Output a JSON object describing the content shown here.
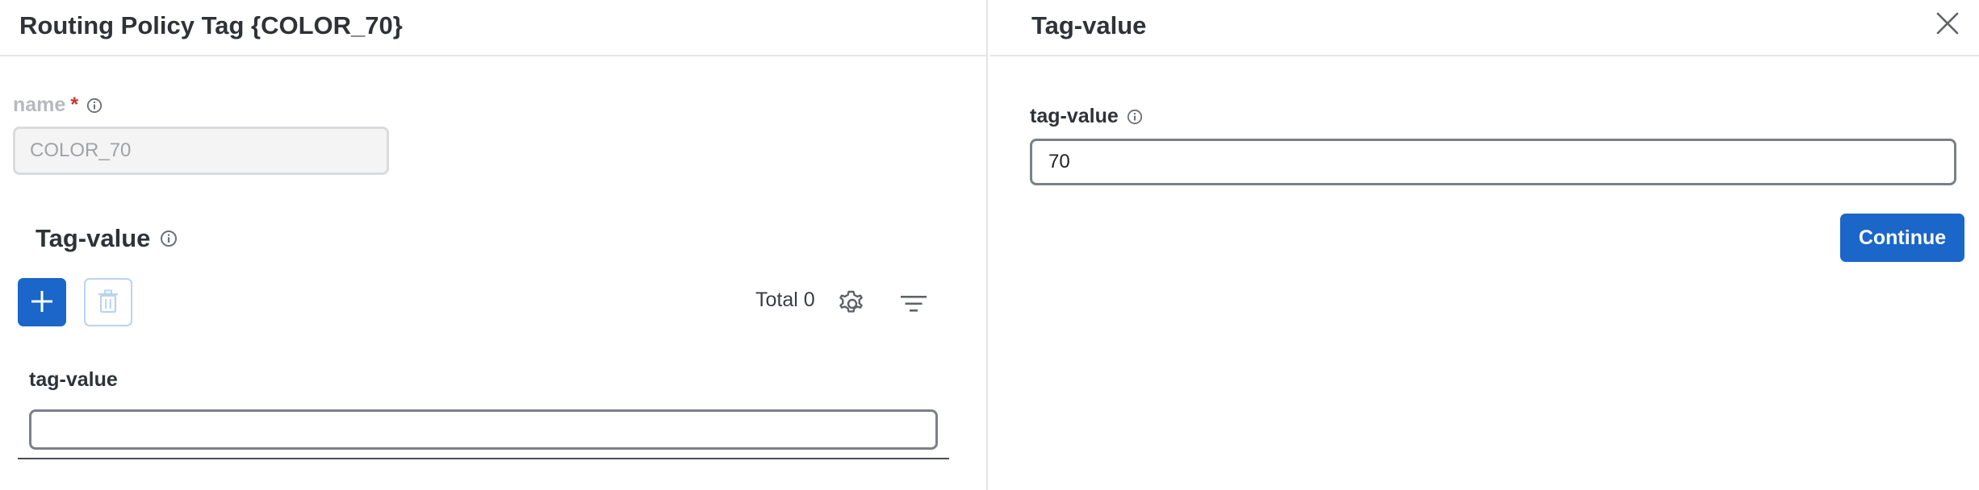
{
  "left_panel": {
    "title": "Routing Policy Tag {COLOR_70}",
    "name_field": {
      "label": "name",
      "required_mark": "*",
      "value": "COLOR_70",
      "disabled": true
    },
    "section": {
      "title": "Tag-value",
      "total_label": "Total 0",
      "column_header": "tag-value",
      "row_value": ""
    },
    "icons": {
      "add": "plus-icon",
      "delete": "trash-icon",
      "settings": "gear-icon",
      "filter": "filter-icon",
      "info": "info-icon"
    }
  },
  "right_panel": {
    "title": "Tag-value",
    "field": {
      "label": "tag-value",
      "value": "70"
    },
    "continue_label": "Continue",
    "close_icon": "close-icon"
  },
  "colors": {
    "primary": "#1a66c9",
    "required": "#d0312d",
    "text": "#2f3338",
    "muted": "#b6b9bd"
  }
}
